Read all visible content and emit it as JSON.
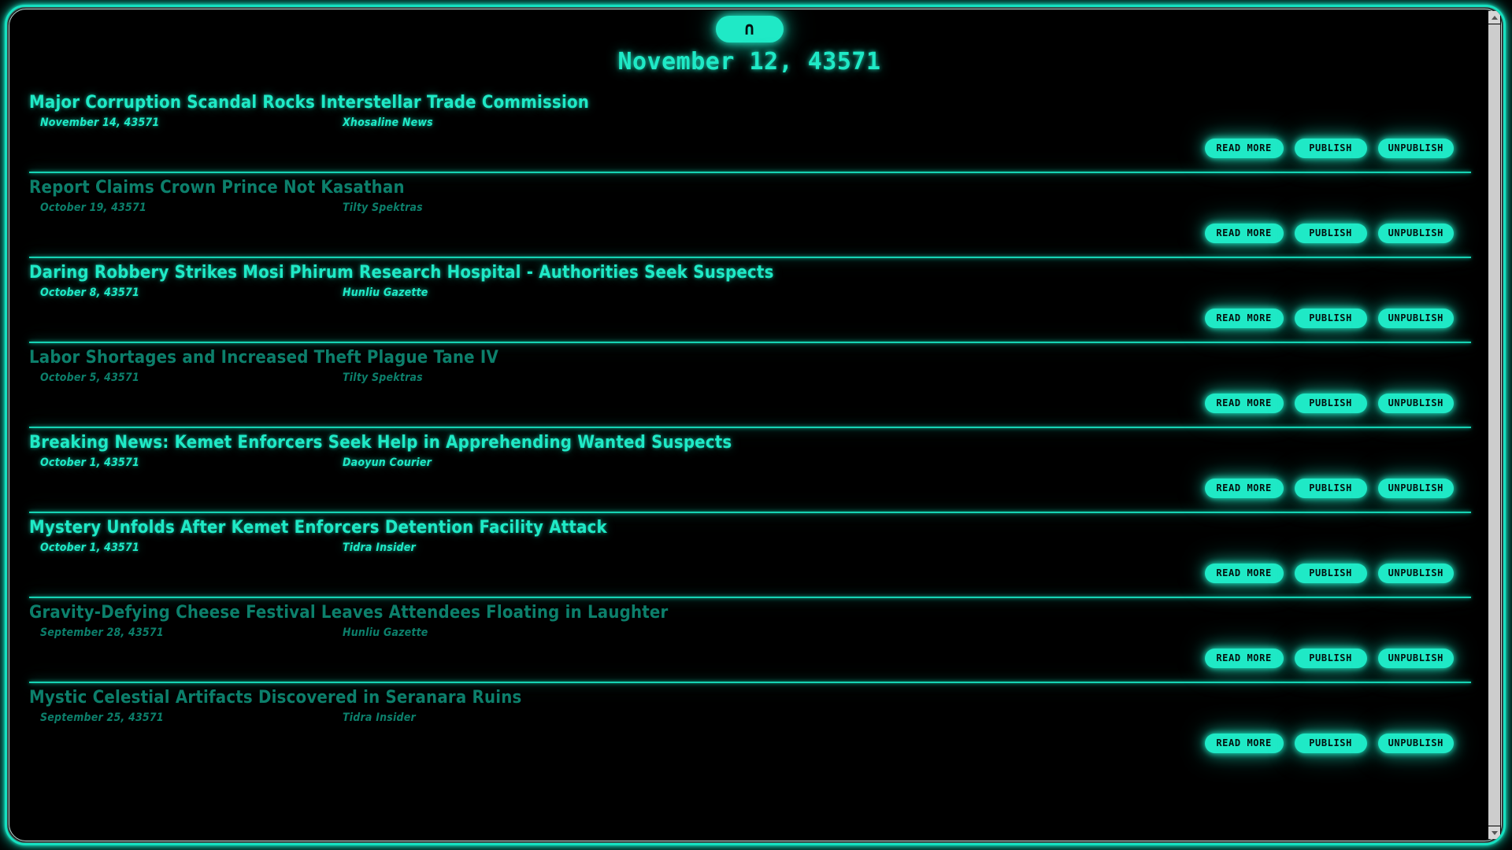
{
  "header": {
    "logo_glyph": "∩",
    "logo_name": "logo-badge",
    "current_date": "November 12, 43571"
  },
  "buttons": {
    "read_more": "READ MORE",
    "publish": "PUBLISH",
    "unpublish": "UNPUBLISH"
  },
  "scrollbar": {
    "up_arrow": "scroll-up-arrow",
    "down_arrow": "scroll-down-arrow"
  },
  "colors": {
    "accent_bright": "#1fe9c6",
    "accent_dim": "#0c7f6b",
    "divider": "#17d3b4",
    "background": "#000000"
  },
  "articles": [
    {
      "title": "Major Corruption Scandal Rocks Interstellar Trade Commission",
      "date": "November 14, 43571",
      "source": "Xhosaline News",
      "state": "published"
    },
    {
      "title": "Report Claims Crown Prince Not Kasathan",
      "date": "October 19, 43571",
      "source": "Tilty Spektras",
      "state": "unpublished"
    },
    {
      "title": "Daring Robbery Strikes Mosi Phirum Research Hospital - Authorities Seek Suspects",
      "date": "October 8, 43571",
      "source": "Hunliu Gazette",
      "state": "published"
    },
    {
      "title": "Labor Shortages and Increased Theft Plague Tane IV",
      "date": "October 5, 43571",
      "source": "Tilty Spektras",
      "state": "unpublished"
    },
    {
      "title": "Breaking News: Kemet Enforcers Seek Help in Apprehending Wanted Suspects",
      "date": "October 1, 43571",
      "source": "Daoyun Courier",
      "state": "published"
    },
    {
      "title": "Mystery Unfolds After Kemet Enforcers Detention Facility Attack",
      "date": "October 1, 43571",
      "source": "Tidra Insider",
      "state": "published"
    },
    {
      "title": "Gravity-Defying Cheese Festival Leaves Attendees Floating in Laughter",
      "date": "September 28, 43571",
      "source": "Hunliu Gazette",
      "state": "unpublished"
    },
    {
      "title": "Mystic Celestial Artifacts Discovered in Seranara Ruins",
      "date": "September 25, 43571",
      "source": "Tidra Insider",
      "state": "unpublished"
    }
  ]
}
